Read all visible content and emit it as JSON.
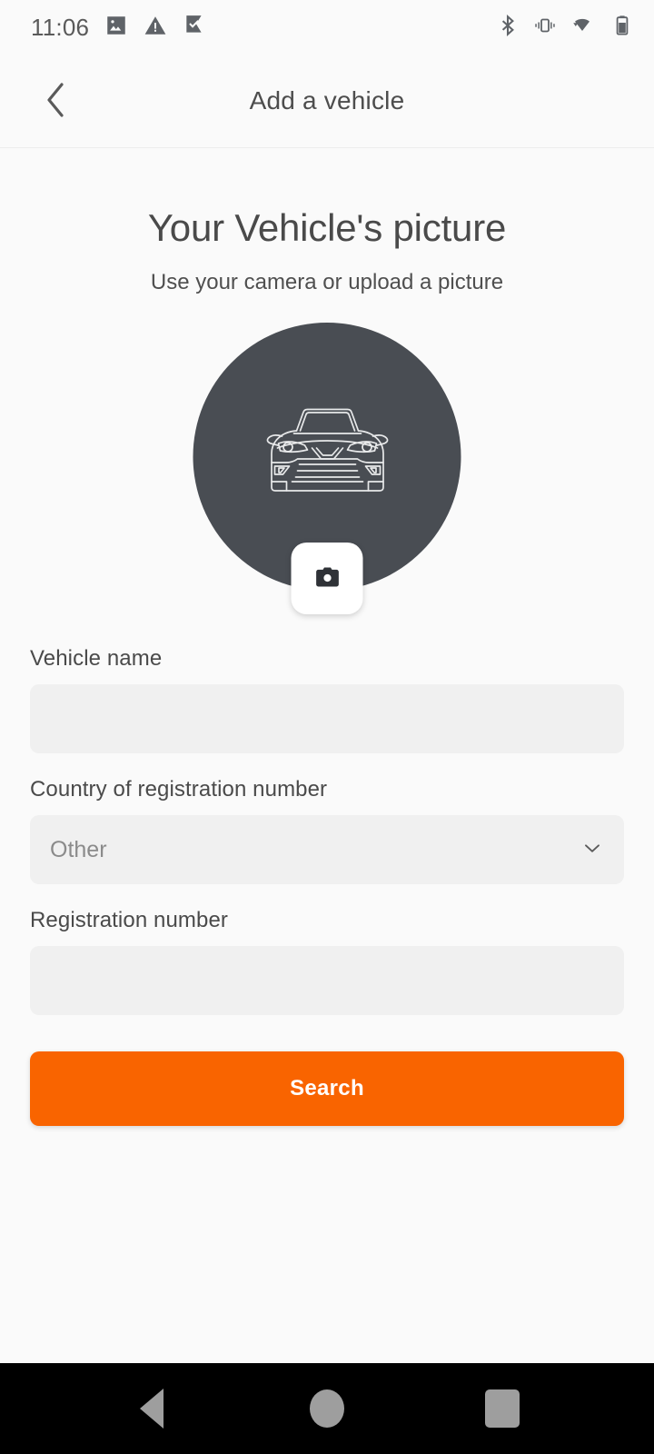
{
  "status_bar": {
    "time": "11:06",
    "left_icons": [
      "image-icon",
      "warning-icon",
      "checkmark-flag-icon"
    ],
    "right_icons": [
      "bluetooth-icon",
      "vibrate-icon",
      "wifi-icon",
      "battery-icon"
    ]
  },
  "app_bar": {
    "back_icon": "chevron-left-icon",
    "title": "Add a vehicle"
  },
  "main": {
    "title": "Your Vehicle's picture",
    "subtitle": "Use your camera or upload a picture",
    "avatar_icon": "car-front-icon",
    "camera_button_icon": "camera-icon"
  },
  "form": {
    "vehicle_name": {
      "label": "Vehicle name",
      "value": "",
      "placeholder": ""
    },
    "country": {
      "label": "Country of registration number",
      "value": "Other",
      "chevron_icon": "chevron-down-icon"
    },
    "registration_number": {
      "label": "Registration number",
      "value": "",
      "placeholder": ""
    },
    "submit_label": "Search"
  },
  "nav_bar": {
    "back_icon": "triangle-back-icon",
    "home_icon": "circle-home-icon",
    "recents_icon": "square-recents-icon"
  },
  "colors": {
    "accent": "#f96400",
    "avatar": "#494d53",
    "page_bg": "#fafafa",
    "field_bg": "#f0f0f0",
    "nav_bg": "#000000"
  }
}
